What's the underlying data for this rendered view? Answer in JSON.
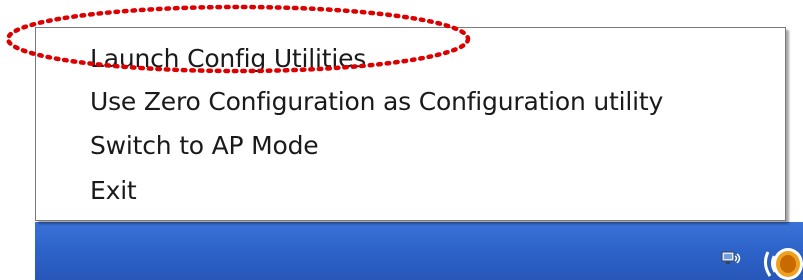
{
  "menu": {
    "items": [
      {
        "label": "Launch Config Utilities"
      },
      {
        "label": "Use Zero Configuration as Configuration utility"
      },
      {
        "label": "Switch to AP Mode"
      },
      {
        "label": "Exit"
      }
    ]
  },
  "annotation": {
    "shape": "dotted-ellipse",
    "color": "#dd0000",
    "target": "Launch Config Utilities"
  },
  "taskbar": {
    "color": "#2d63c9",
    "tray_icons": [
      "network-connection-icon",
      "wireless-utility-icon"
    ]
  }
}
